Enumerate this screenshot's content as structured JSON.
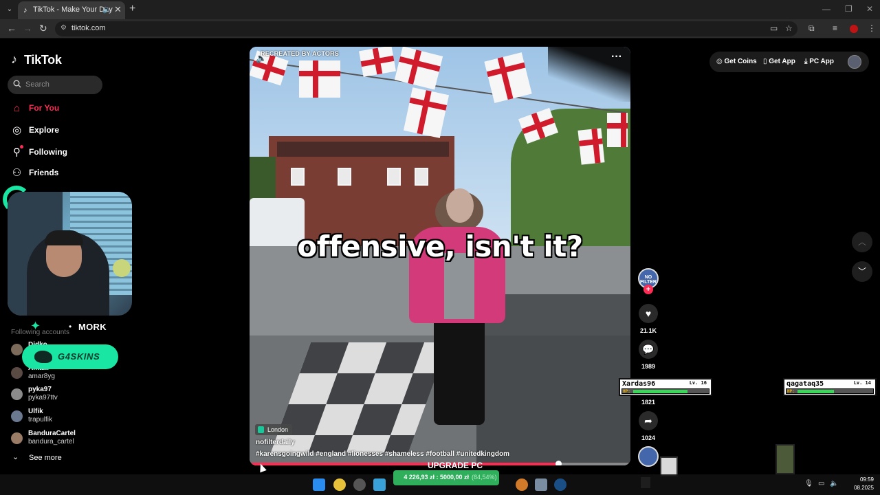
{
  "browser": {
    "tab_title": "TikTok - Make Your Day",
    "url": "tiktok.com"
  },
  "sidebar": {
    "logo": "TikTok",
    "search_placeholder": "Search",
    "nav": [
      {
        "label": "For You",
        "icon": "home-icon",
        "active": true
      },
      {
        "label": "Explore",
        "icon": "compass-icon",
        "active": false
      },
      {
        "label": "Following",
        "icon": "following-icon",
        "active": false
      },
      {
        "label": "Friends",
        "icon": "friends-icon",
        "active": false
      }
    ],
    "following_header": "Following accounts",
    "accounts": [
      {
        "name": "Didko",
        "handle": ""
      },
      {
        "name": "Ama...",
        "handle": "amar8yg"
      },
      {
        "name": "pyka97",
        "handle": "pyka97ttv"
      },
      {
        "name": "Ulfik",
        "handle": "trapulfik"
      },
      {
        "name": "BanduraCartel",
        "handle": "bandura_cartel"
      }
    ],
    "see_more": "See more"
  },
  "overlay": {
    "streamer": "MORK",
    "sponsor": "G4SKINS",
    "upgrade_label": "UPGRADE PC",
    "goal_amount": "4 226,93 zł  :  5000,00 zł",
    "goal_percent": "(84,54%)",
    "goal_progress": 0.8454
  },
  "video": {
    "tag": "RECREATED BY ACTORS",
    "caption": "offensive, isn't it?",
    "location": "London",
    "author": "nofilterdaily",
    "hashtags": "#karensgoingwild #england #lionesses #shameless #football #unitedkingdom",
    "progress": 0.81
  },
  "rail": {
    "avatar_text": "NO FILTER",
    "likes": "21.1K",
    "comments": "1989",
    "saves": "1821",
    "shares": "1024"
  },
  "hp_cards": [
    {
      "name": "Xardas96",
      "level": "Lv. 16",
      "hp_label": "HP:",
      "hp": 0.72
    },
    {
      "name": "qagataq35",
      "level": "Lv. 14",
      "hp_label": "HP:",
      "hp": 0.48
    }
  ],
  "header": {
    "get_coins": "Get Coins",
    "get_app": "Get App",
    "pc_app": "PC App"
  },
  "taskbar": {
    "time": "09:59",
    "date": "08.2025"
  },
  "colors": {
    "accent": "#fe2c55",
    "sponsor": "#19e6a3",
    "goal": "#2fae5c"
  }
}
